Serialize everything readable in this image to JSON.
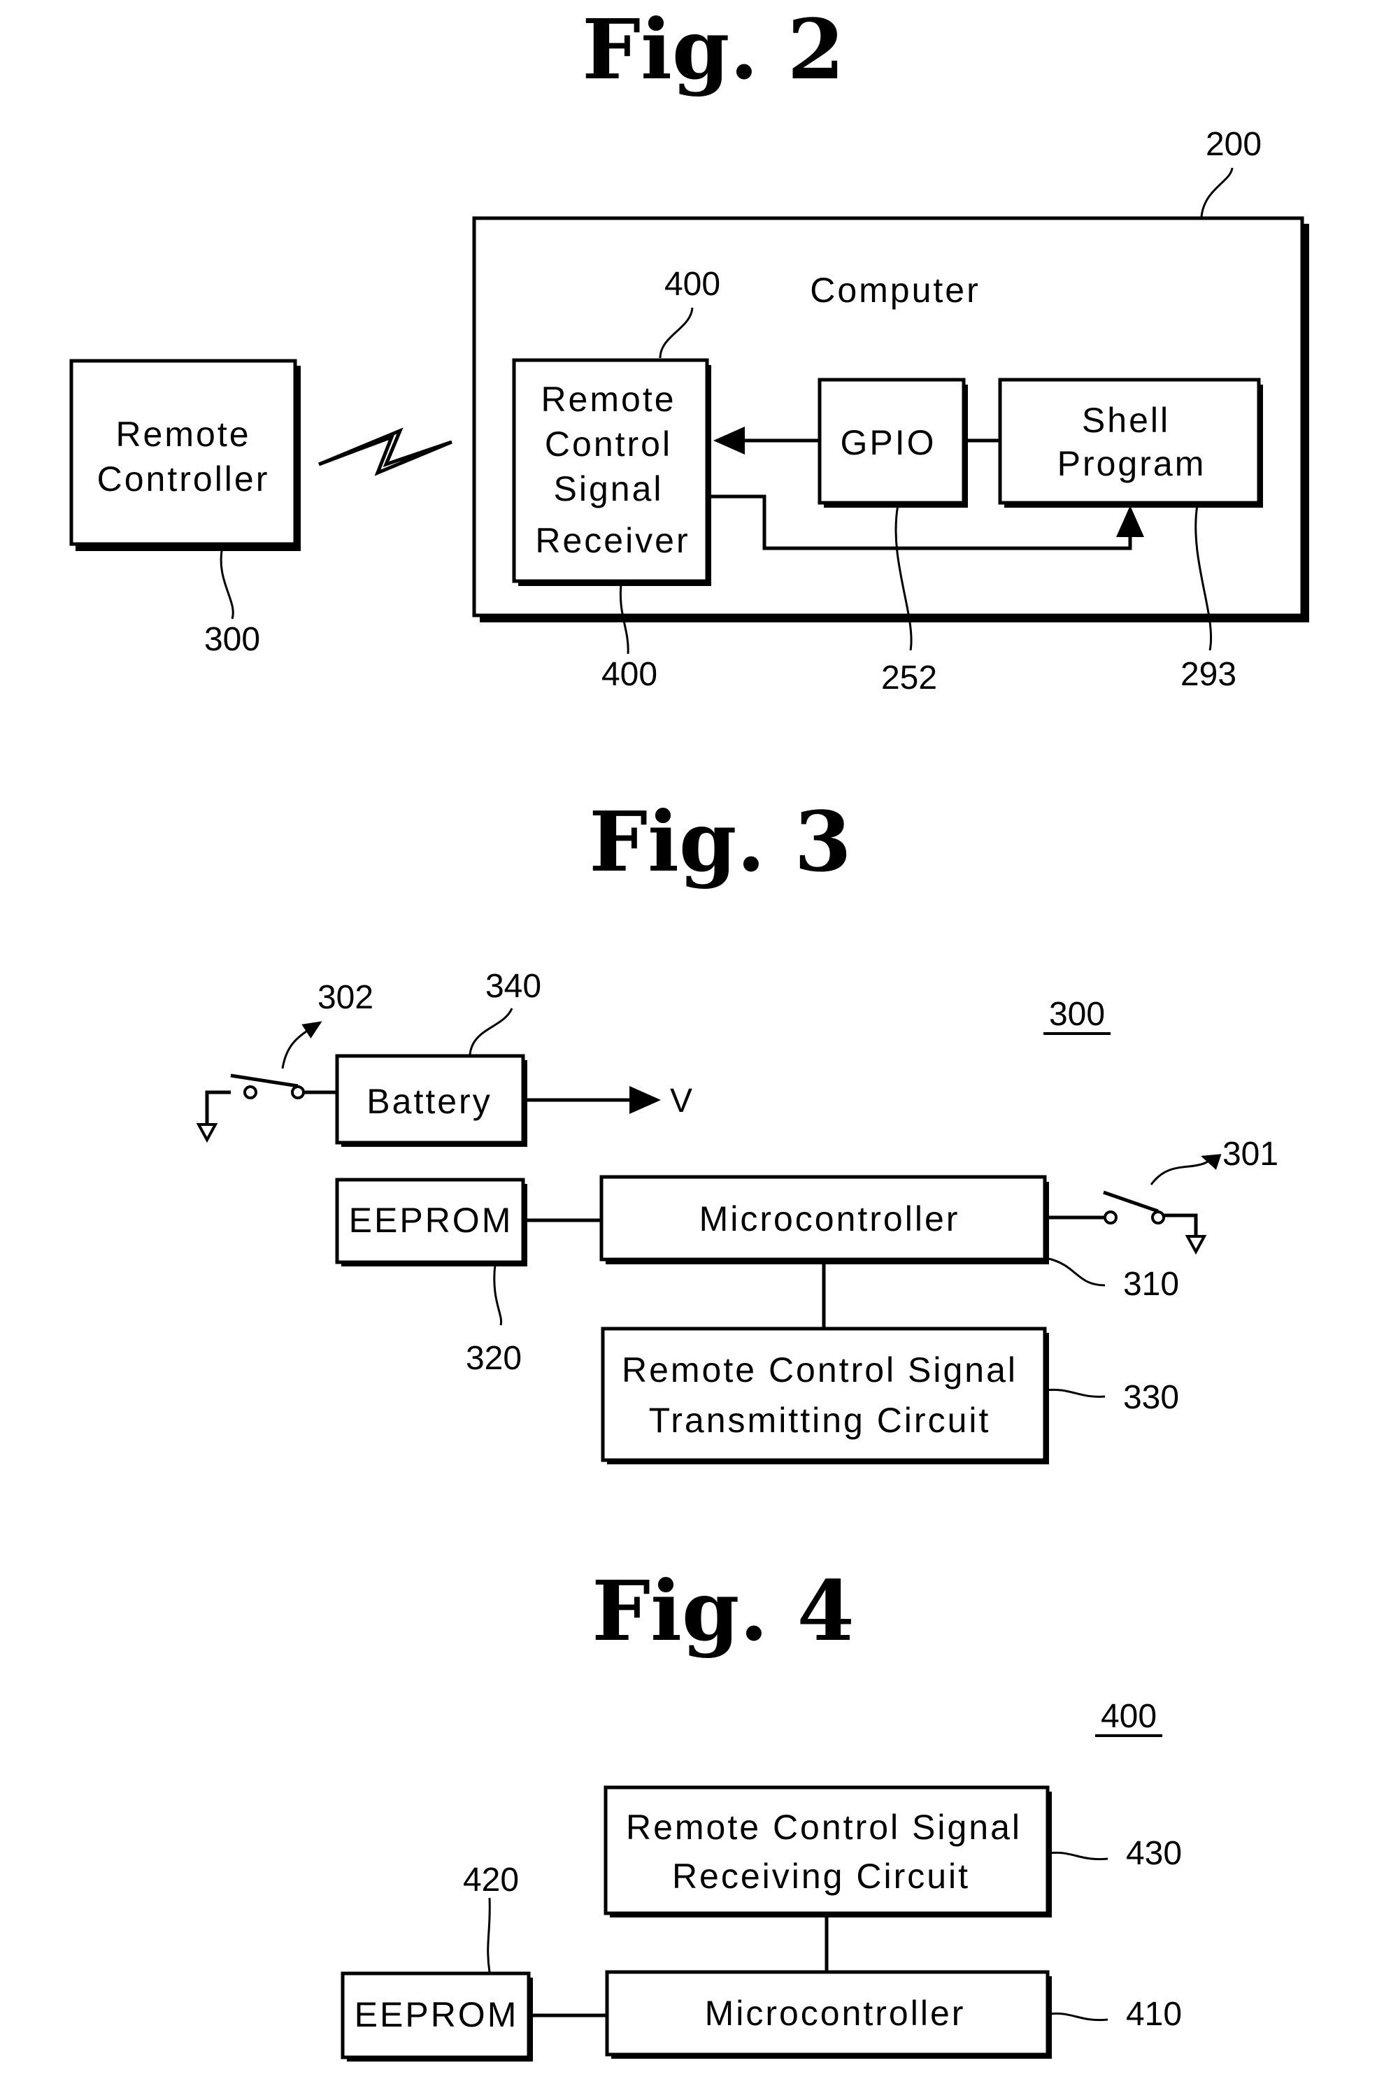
{
  "fig2": {
    "title": "Fig. 2",
    "remote_controller": {
      "lines": [
        "Remote",
        "Controller"
      ],
      "ref": "300"
    },
    "computer": {
      "label": "Computer",
      "ref": "200"
    },
    "receiver": {
      "lines": [
        "Remote",
        "Control",
        "Signal",
        "Receiver"
      ],
      "ref_top": "400",
      "ref_bottom": "400"
    },
    "gpio": {
      "label": "GPIO",
      "ref": "252"
    },
    "shell": {
      "lines": [
        "Shell",
        "Program"
      ],
      "ref": "293"
    }
  },
  "fig3": {
    "title": "Fig. 3",
    "assembly_ref": "300",
    "switch_power": {
      "ref": "302"
    },
    "battery": {
      "label": "Battery",
      "ref": "340",
      "output_label": "V"
    },
    "eeprom": {
      "label": "EEPROM",
      "ref": "320"
    },
    "microcontroller": {
      "label": "Microcontroller",
      "ref": "310"
    },
    "switch_key": {
      "ref": "301"
    },
    "transmitter": {
      "lines": [
        "Remote Control Signal",
        "Transmitting Circuit"
      ],
      "ref": "330"
    }
  },
  "fig4": {
    "title": "Fig. 4",
    "assembly_ref": "400",
    "receiver_circuit": {
      "lines": [
        "Remote Control Signal",
        "Receiving Circuit"
      ],
      "ref": "430"
    },
    "eeprom": {
      "label": "EEPROM",
      "ref": "420"
    },
    "microcontroller": {
      "label": "Microcontroller",
      "ref": "410"
    }
  }
}
